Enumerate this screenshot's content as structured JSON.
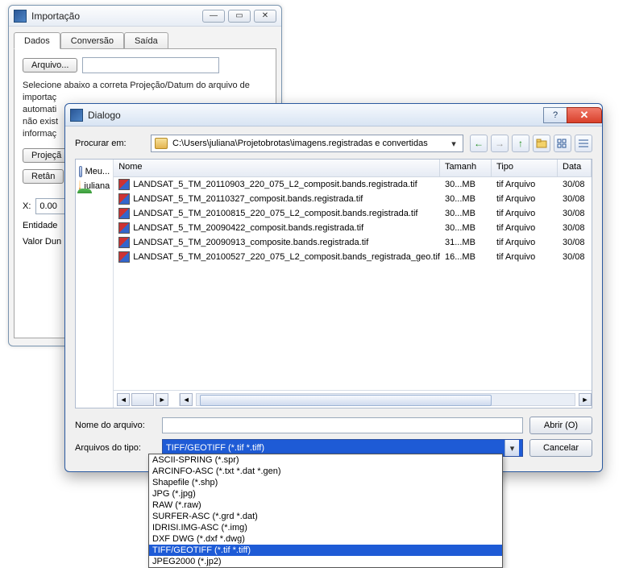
{
  "import_window": {
    "title": "Importação",
    "tabs": {
      "dados": "Dados",
      "conversao": "Conversão",
      "saida": "Saída"
    },
    "arquivo_btn": "Arquivo...",
    "help_text": "Selecione abaixo a correta Projeção/Datum do arquivo de importaç\nautomati\nnão exist\ninformaç",
    "projecao_btn": "Projeçã",
    "retang_btn": "Retân",
    "x_label": "X:",
    "x_value": "0.00",
    "entidade_label": "Entidade",
    "valor_dun_label": "Valor Dun"
  },
  "dialog": {
    "title": "Dialogo",
    "lookin_label": "Procurar em:",
    "lookin_path": "C:\\Users\\juliana\\Projetobrotas\\imagens.registradas e convertidas",
    "places": {
      "computer": "Meu...",
      "user": "juliana"
    },
    "columns": {
      "name": "Nome",
      "size": "Tamanh",
      "type": "Tipo",
      "date": "Data"
    },
    "files": [
      {
        "name": "LANDSAT_5_TM_20110903_220_075_L2_composit.bands.registrada.tif",
        "size": "30...MB",
        "type": "tif Arquivo",
        "date": "30/08"
      },
      {
        "name": "LANDSAT_5_TM_20110327_composit.bands.registrada.tif",
        "size": "30...MB",
        "type": "tif Arquivo",
        "date": "30/08"
      },
      {
        "name": "LANDSAT_5_TM_20100815_220_075_L2_composit.bands.registrada.tif",
        "size": "30...MB",
        "type": "tif Arquivo",
        "date": "30/08"
      },
      {
        "name": "LANDSAT_5_TM_20090422_composit.bands.registrada.tif",
        "size": "30...MB",
        "type": "tif Arquivo",
        "date": "30/08"
      },
      {
        "name": "LANDSAT_5_TM_20090913_composite.bands.registrada.tif",
        "size": "31...MB",
        "type": "tif Arquivo",
        "date": "30/08"
      },
      {
        "name": "LANDSAT_5_TM_20100527_220_075_L2_composit.bands_registrada_geo.tif",
        "size": "16...MB",
        "type": "tif Arquivo",
        "date": "30/08"
      }
    ],
    "filename_label": "Nome do arquivo:",
    "filetype_label": "Arquivos do tipo:",
    "filetype_value": "TIFF/GEOTIFF (*.tif *.tiff)",
    "open_btn": "Abrir (O)",
    "cancel_btn": "Cancelar",
    "filetype_options": [
      "ASCII-SPRING (*.spr)",
      "ARCINFO-ASC (*.txt *.dat *.gen)",
      "Shapefile (*.shp)",
      "JPG (*.jpg)",
      "RAW (*.raw)",
      "SURFER-ASC (*.grd *.dat)",
      "IDRISI.IMG-ASC (*.img)",
      "DXF DWG (*.dxf *.dwg)",
      "TIFF/GEOTIFF (*.tif *.tiff)",
      "JPEG2000 (*.jp2)"
    ],
    "filetype_selected_index": 8
  }
}
